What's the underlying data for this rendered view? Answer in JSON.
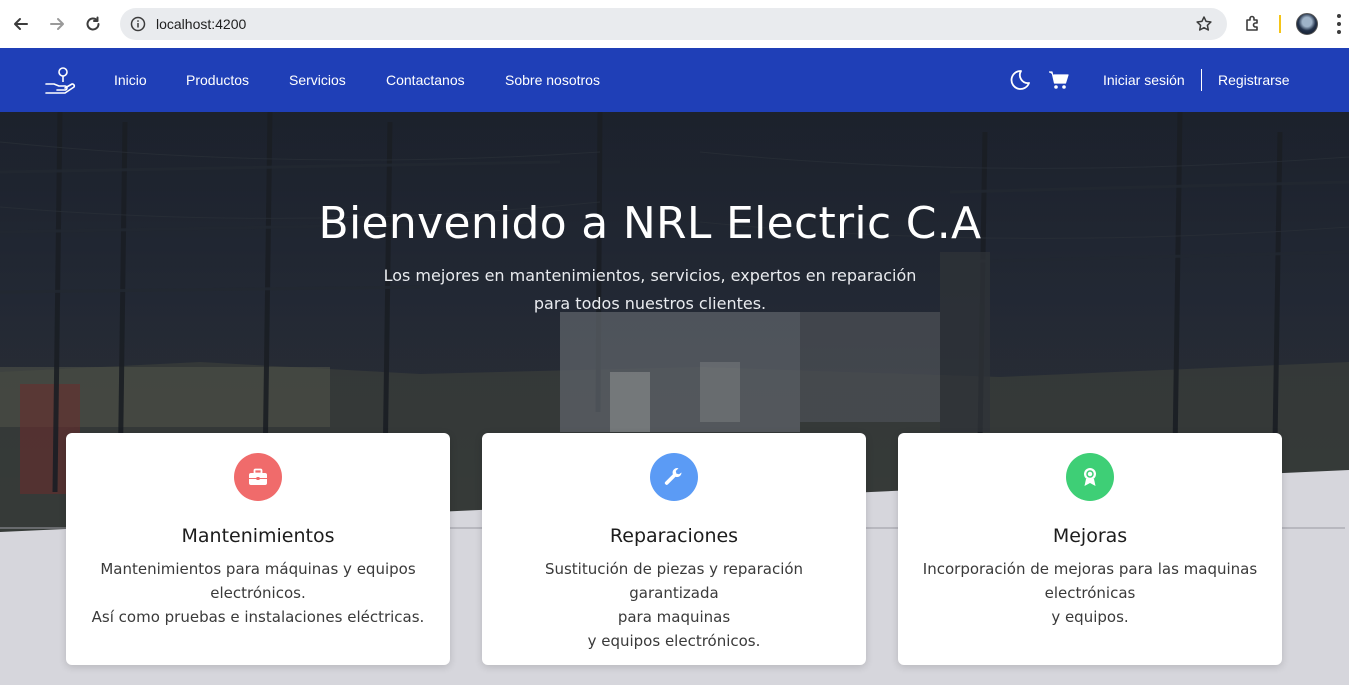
{
  "browser": {
    "url": "localhost:4200"
  },
  "navbar": {
    "links": [
      "Inicio",
      "Productos",
      "Servicios",
      "Contactanos",
      "Sobre nosotros"
    ],
    "login_label": "Iniciar sesión",
    "register_label": "Registrarse",
    "icons": [
      "logo-icon",
      "moon-icon",
      "cart-icon"
    ]
  },
  "hero": {
    "title": "Bienvenido a NRL Electric C.A",
    "subtitle_line1": "Los mejores en mantenimientos, servicios, expertos en reparación",
    "subtitle_line2": "para todos nuestros clientes."
  },
  "cards": [
    {
      "icon": "briefcase-icon",
      "color": "#f06b6b",
      "title": "Mantenimientos",
      "lines": [
        "Mantenimientos para máquinas y equipos",
        "electrónicos.",
        "Así como pruebas e instalaciones eléctricas."
      ]
    },
    {
      "icon": "wrench-icon",
      "color": "#5b9bf5",
      "title": "Reparaciones",
      "lines": [
        "Sustitución de piezas y reparación garantizada",
        "para maquinas",
        "y equipos electrónicos."
      ]
    },
    {
      "icon": "award-icon",
      "color": "#3ecf76",
      "title": "Mejoras",
      "lines": [
        "Incorporación de mejoras para las maquinas",
        "electrónicas",
        "y equipos."
      ]
    }
  ],
  "colors": {
    "navbar": "#1f3fb7",
    "page_background": "#d6d6dc"
  }
}
